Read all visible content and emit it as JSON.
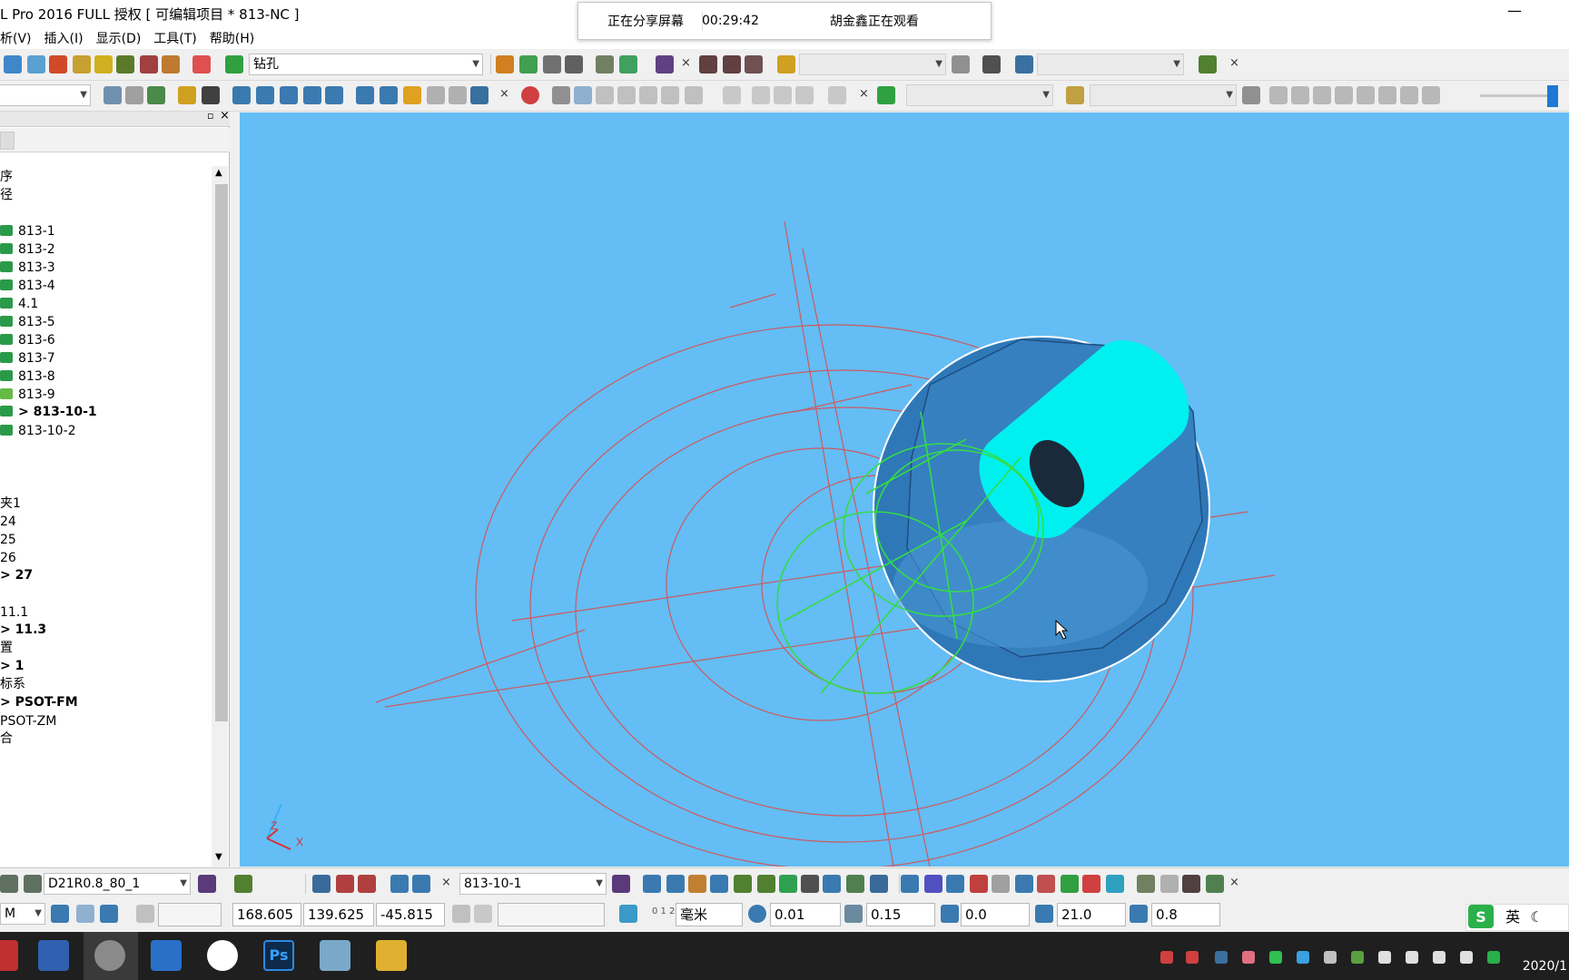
{
  "window": {
    "title": "L Pro 2016 FULL 授权    [ 可编辑项目 * 813-NC ]",
    "minimize": "—"
  },
  "share": {
    "status": "正在分享屏幕",
    "elapsed": "00:29:42",
    "viewer": "胡金鑫正在观看"
  },
  "menu": [
    "析(V)",
    "插入(I)",
    "显示(D)",
    "工具(T)",
    "帮助(H)"
  ],
  "toolbar1": {
    "operation_combo": "钻孔",
    "close_glyph": "×"
  },
  "toolbar2": {
    "close_glyph": "×"
  },
  "panel": {
    "close_glyph": "×",
    "pin_glyph": "▫"
  },
  "tree": [
    {
      "text": "序",
      "bold": false,
      "icon": "none"
    },
    {
      "text": "径",
      "bold": false,
      "icon": "none"
    },
    {
      "text": "813-1",
      "bold": false,
      "icon": "toolpath-icon"
    },
    {
      "text": "813-2",
      "bold": false,
      "icon": "toolpath-icon"
    },
    {
      "text": "813-3",
      "bold": false,
      "icon": "toolpath-icon"
    },
    {
      "text": "813-4",
      "bold": false,
      "icon": "toolpath-icon"
    },
    {
      "text": "4.1",
      "bold": false,
      "icon": "toolpath-icon"
    },
    {
      "text": "813-5",
      "bold": false,
      "icon": "toolpath-icon"
    },
    {
      "text": "813-6",
      "bold": false,
      "icon": "toolpath-icon"
    },
    {
      "text": "813-7",
      "bold": false,
      "icon": "toolpath-icon"
    },
    {
      "text": "813-8",
      "bold": false,
      "icon": "toolpath-icon"
    },
    {
      "text": "813-9",
      "bold": false,
      "icon": "toolpath-alt-icon"
    },
    {
      "text": "> 813-10-1",
      "bold": true,
      "icon": "toolpath-icon"
    },
    {
      "text": "813-10-2",
      "bold": false,
      "icon": "toolpath-icon"
    },
    {
      "text": "夹1",
      "bold": false,
      "icon": "none"
    },
    {
      "text": "24",
      "bold": false,
      "icon": "none"
    },
    {
      "text": "25",
      "bold": false,
      "icon": "none"
    },
    {
      "text": "26",
      "bold": false,
      "icon": "none"
    },
    {
      "text": "> 27",
      "bold": true,
      "icon": "none"
    },
    {
      "text": "11.1",
      "bold": false,
      "icon": "none"
    },
    {
      "text": "> 11.3",
      "bold": true,
      "icon": "none"
    },
    {
      "text": "置",
      "bold": false,
      "icon": "none"
    },
    {
      "text": "> 1",
      "bold": true,
      "icon": "none"
    },
    {
      "text": "标系",
      "bold": false,
      "icon": "none"
    },
    {
      "text": "> PSOT-FM",
      "bold": true,
      "icon": "none"
    },
    {
      "text": "PSOT-ZM",
      "bold": false,
      "icon": "none"
    },
    {
      "text": "合",
      "bold": false,
      "icon": "none"
    }
  ],
  "viewport": {
    "axis_z": "Z",
    "axis_x": "X",
    "colors": {
      "background": "#64bdf4",
      "part": "#2f78b8",
      "cyan": "#00f0f0",
      "wire": "#d85050",
      "toolpath": "#33dd44"
    }
  },
  "bottom1": {
    "tool_combo": "D21R0.8_80_1",
    "toolpath_combo": "813-10-1",
    "close_glyph": "×"
  },
  "bottom2": {
    "x": "168.605",
    "y": "139.625",
    "z": "-45.815",
    "units": "毫米",
    "tolerance": "0.01",
    "stock": "0.15",
    "tip_value": "0.0",
    "diameter": "21.0",
    "corner": "0.8",
    "units_icon_label": "0 1 2"
  },
  "ime": {
    "label": "英"
  },
  "clock": {
    "date": "2020/1"
  }
}
